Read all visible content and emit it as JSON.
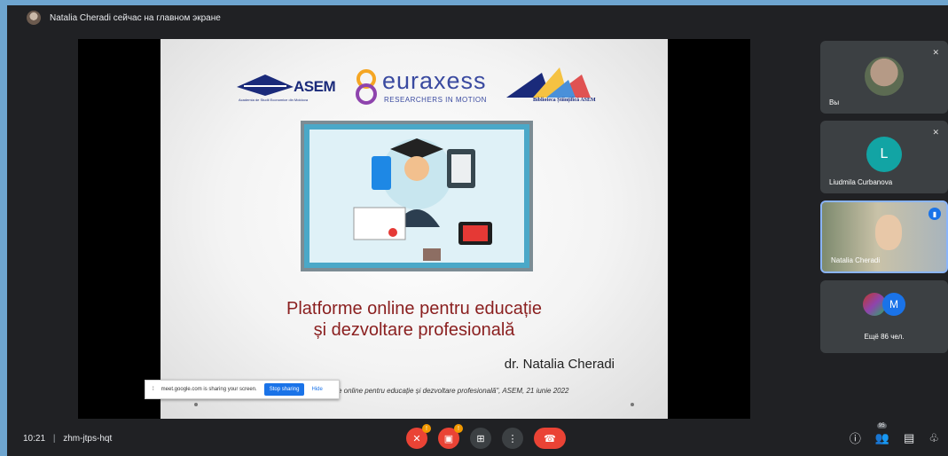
{
  "topbar": {
    "presenter_status": "Natalia Cheradi сейчас на главном экране"
  },
  "slide": {
    "logos": {
      "asem": "ASEM",
      "asem_subtitle": "Academia de Studii Economice din Moldova",
      "euraxess": "EURAXESS",
      "euraxess_subtitle": "RESEARCHERS IN MOTION",
      "biblioteca": "Biblioteca Științifică ASEM"
    },
    "title_line1": "Platforme online pentru educație",
    "title_line2": "și dezvoltare profesională",
    "author": "dr. Natalia Cheradi",
    "footnote": "e online pentru educație și dezvoltare profesională\", ASEM, 21 iunie 2022"
  },
  "share_bar": {
    "message": "meet.google.com is sharing your screen.",
    "stop_label": "Stop sharing",
    "hide_label": "Hide"
  },
  "participants": [
    {
      "name": "Вы",
      "muted": true
    },
    {
      "name": "Liudmila Curbanova",
      "initial": "L",
      "muted": true
    },
    {
      "name": "Natalia Cheradi",
      "speaking": true
    },
    {
      "name": "Ещё 86 чел.",
      "initial": "M"
    }
  ],
  "bottombar": {
    "time": "10:21",
    "separator": "|",
    "meeting_code": "zhm-jtps-hqt",
    "people_count": "95",
    "mic_badge": "!",
    "cam_badge": "!"
  },
  "colors": {
    "accent": "#1a73e8",
    "hangup": "#ea4335",
    "background": "#202124",
    "title_red": "#8a1f1f"
  }
}
